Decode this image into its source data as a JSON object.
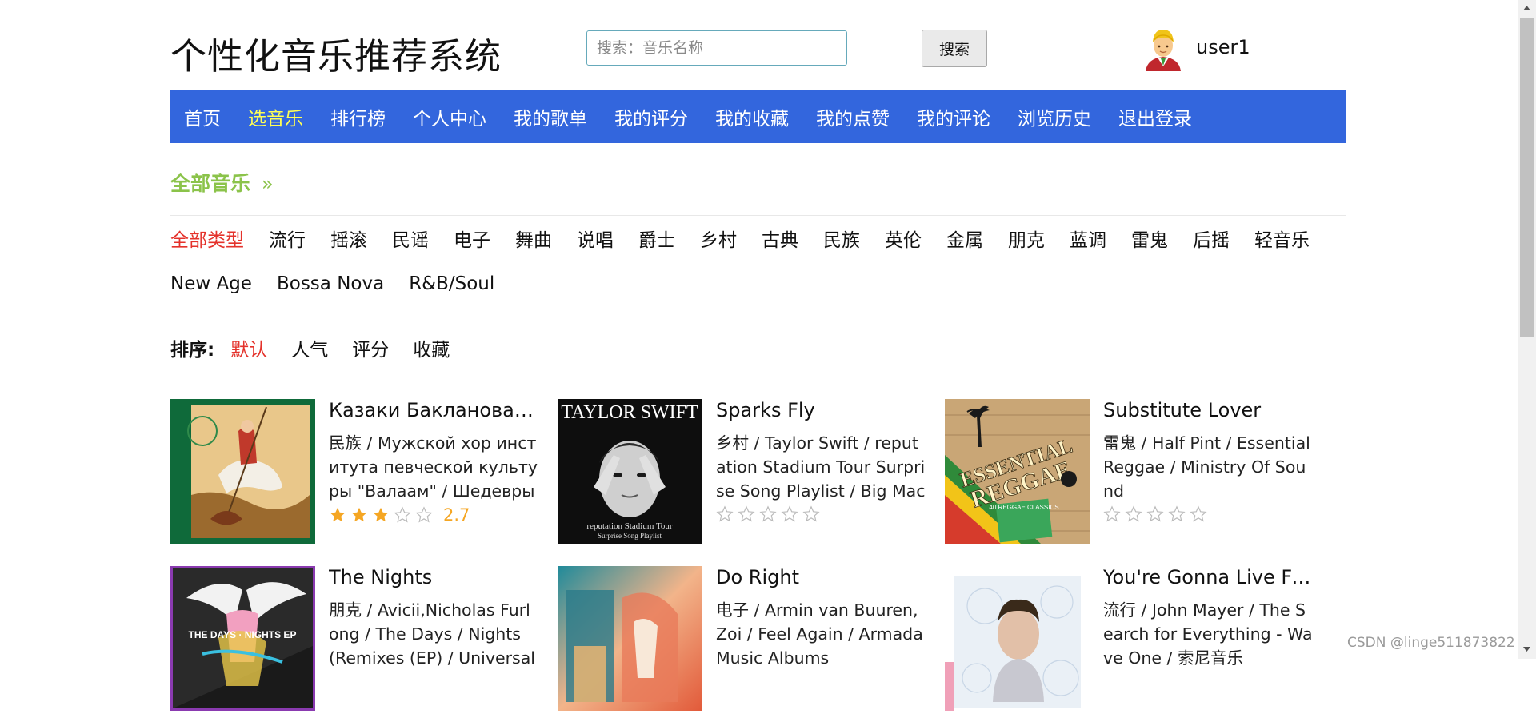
{
  "header": {
    "site_title": "个性化音乐推荐系统",
    "search_placeholder": "搜索：音乐名称",
    "search_button": "搜索",
    "username": "user1"
  },
  "nav": [
    "首页",
    "选音乐",
    "排行榜",
    "个人中心",
    "我的歌单",
    "我的评分",
    "我的收藏",
    "我的点赞",
    "我的评论",
    "浏览历史",
    "退出登录"
  ],
  "nav_active": "选音乐",
  "section": {
    "title": "全部音乐",
    "arrow": "»"
  },
  "genres": [
    "全部类型",
    "流行",
    "摇滚",
    "民谣",
    "电子",
    "舞曲",
    "说唱",
    "爵士",
    "乡村",
    "古典",
    "民族",
    "英伦",
    "金属",
    "朋克",
    "蓝调",
    "雷鬼",
    "后摇",
    "轻音乐",
    "New Age",
    "Bossa Nova",
    "R&B/Soul"
  ],
  "genre_active": "全部类型",
  "sort": {
    "label": "排序:",
    "options": [
      "默认",
      "人气",
      "评分",
      "收藏"
    ],
    "active": "默认"
  },
  "songs": [
    {
      "title": "Казаки Бакланова на...",
      "info": "民族 / Мужской хор института певческой культуры \"Валаам\"  / Шедевры пра",
      "rating": "2.7",
      "stars": 2.7,
      "cover": "icon-painting"
    },
    {
      "title": "Sparks Fly",
      "info": "乡村 / Taylor Swift  / reputation Stadium Tour Surprise Song Playlist / Big Machi",
      "rating": "",
      "stars": 0,
      "cover_text": "TAYLOR SWIFT",
      "cover_sub1": "reputation Stadium Tour",
      "cover_sub2": "Surprise Song Playlist"
    },
    {
      "title": "Substitute Lover",
      "info": "雷鬼 / Half Pint  / Essential Reggae / Ministry Of Sound",
      "rating": "",
      "stars": 0,
      "cover_text1": "ESSENTIAL",
      "cover_text2": "REGGAE",
      "cover_sub": "40 REGGAE CLASSICS"
    },
    {
      "title": "The Nights",
      "info": "朋克 / Avicii,Nicholas Furlong  / The Days / Nights (Remixes (EP) / Universal Mu",
      "rating": "",
      "stars": 0,
      "cover_text": "THE DAYS · NIGHTS EP"
    },
    {
      "title": "Do Right",
      "info": "电子 / Armin van Buuren,Zoi  / Feel Again / Armada Music Albums",
      "rating": "",
      "stars": 0,
      "cover": "abstract-art"
    },
    {
      "title": "You're Gonna Live For...",
      "info": "流行 / John Mayer  / The Search for Everything - Wave One / 索尼音乐",
      "rating": "",
      "stars": 0,
      "cover": "portrait"
    }
  ],
  "colors": {
    "nav_bg": "#3366dd",
    "nav_active": "#ffff55",
    "accent_green": "#8bc34a",
    "accent_red": "#e4322b",
    "star": "#f5a623"
  },
  "watermark": "CSDN @linge511873822"
}
